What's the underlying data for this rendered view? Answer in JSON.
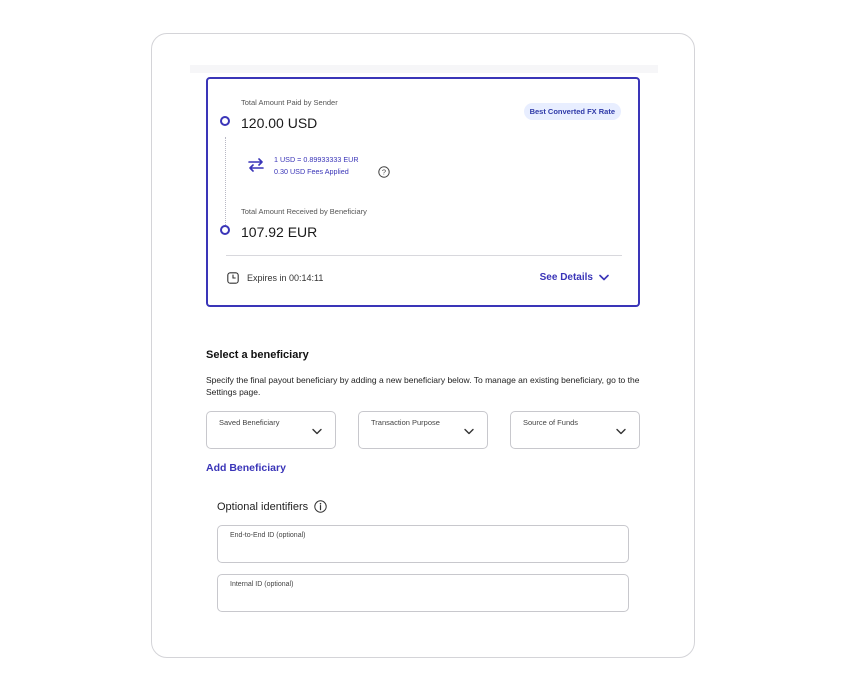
{
  "quote": {
    "sender_label": "Total Amount Paid by Sender",
    "sender_amount": "120.00 USD",
    "badge": "Best Converted FX Rate",
    "rate": "1 USD = 0.89933333 EUR",
    "fees": "0.30 USD Fees Applied",
    "beneficiary_label": "Total Amount Received by Beneficiary",
    "beneficiary_amount": "107.92 EUR",
    "expires": "Expires in 00:14:11",
    "see_details": "See Details"
  },
  "beneficiary": {
    "title": "Select a beneficiary",
    "description": "Specify the final payout beneficiary by adding a new beneficiary below. To manage an existing beneficiary, go to the Settings page.",
    "dropdowns": [
      {
        "label": "Saved Beneficiary"
      },
      {
        "label": "Transaction Purpose"
      },
      {
        "label": "Source of Funds"
      }
    ],
    "add_label": "Add Beneficiary"
  },
  "optional": {
    "title": "Optional identifiers",
    "fields": [
      {
        "label": "End-to-End ID (optional)",
        "value": ""
      },
      {
        "label": "Internal ID (optional)",
        "value": ""
      }
    ]
  },
  "colors": {
    "accent": "#3a35b8",
    "badge_bg": "#e8eeff"
  }
}
